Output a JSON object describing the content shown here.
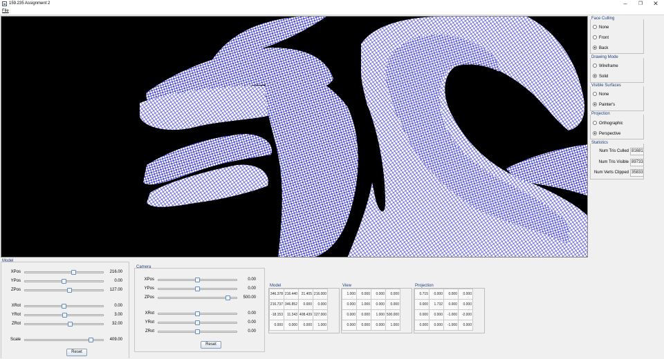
{
  "window": {
    "title": "159.235 Assignment 2",
    "minimize": "–",
    "maximize": "❐",
    "close": "✕"
  },
  "menu": {
    "file": "File"
  },
  "colors": {
    "viewport_bg": "#000000",
    "wire": "#ffffff",
    "fill": "#1c1ccc",
    "accent": "#1f3f7a"
  },
  "right_panel": {
    "face_culling": {
      "title": "Face Culling",
      "options": [
        "None",
        "Front",
        "Back"
      ],
      "selected": "Back"
    },
    "drawing_mode": {
      "title": "Drawing Mode",
      "options": [
        "Wireframe",
        "Solid"
      ],
      "selected": "Solid"
    },
    "visible_surfaces": {
      "title": "Visible Surfaces",
      "options": [
        "None",
        "Painter's"
      ],
      "selected": "Painter's"
    },
    "projection": {
      "title": "Projection",
      "options": [
        "Orthographic",
        "Perspective"
      ],
      "selected": "Perspective"
    },
    "statistics": {
      "title": "Statistics",
      "items": [
        {
          "label": "Num Tris Culled",
          "value": "81681"
        },
        {
          "label": "Num Tris Visible",
          "value": "89733"
        },
        {
          "label": "Num Verts Clipped",
          "value": "35833"
        }
      ]
    }
  },
  "model": {
    "title": "Model",
    "sliders": [
      {
        "label": "XPos",
        "value": "216.00",
        "fraction": 0.62
      },
      {
        "label": "YPos",
        "value": "0.00",
        "fraction": 0.5
      },
      {
        "label": "ZPos",
        "value": "127.00",
        "fraction": 0.57
      },
      {
        "label": "XRot",
        "value": "0.00",
        "fraction": 0.5
      },
      {
        "label": "YRot",
        "value": "3.00",
        "fraction": 0.51
      },
      {
        "label": "ZRot",
        "value": "32.00",
        "fraction": 0.58
      },
      {
        "label": "Scale",
        "value": "409.00",
        "fraction": 0.84
      }
    ],
    "reset": "Reset"
  },
  "camera": {
    "title": "Camera",
    "sliders": [
      {
        "label": "XPos",
        "value": "0.00",
        "fraction": 0.5
      },
      {
        "label": "YPos",
        "value": "0.00",
        "fraction": 0.5
      },
      {
        "label": "ZPos",
        "value": "500.00",
        "fraction": 0.88
      },
      {
        "label": "XRot",
        "value": "0.00",
        "fraction": 0.5
      },
      {
        "label": "YRot",
        "value": "0.00",
        "fraction": 0.5
      },
      {
        "label": "ZRot",
        "value": "0.00",
        "fraction": 0.5
      }
    ],
    "reset": "Reset"
  },
  "matrices": [
    {
      "title": "Model",
      "rows": [
        [
          "346.378",
          "216.440",
          "21.405",
          "216.000"
        ],
        [
          "216.737",
          "346.852",
          "0.000",
          "0.000"
        ],
        [
          "-18.153",
          "11.343",
          "408.439",
          "127.000"
        ],
        [
          "0.000",
          "0.000",
          "0.000",
          "1.000"
        ]
      ]
    },
    {
      "title": "View",
      "rows": [
        [
          "1.000",
          "0.000",
          "0.000",
          "0.000"
        ],
        [
          "0.000",
          "1.000",
          "0.000",
          "0.000"
        ],
        [
          "0.000",
          "0.000",
          "1.000",
          "500.000"
        ],
        [
          "0.000",
          "0.000",
          "0.000",
          "1.000"
        ]
      ]
    },
    {
      "title": "Projection",
      "rows": [
        [
          "0.715",
          "0.000",
          "0.000",
          "0.000"
        ],
        [
          "0.000",
          "1.732",
          "0.000",
          "0.000"
        ],
        [
          "0.000",
          "0.000",
          "-1.000",
          "-2.000"
        ],
        [
          "0.000",
          "0.000",
          "-1.000",
          "0.000"
        ]
      ]
    }
  ]
}
